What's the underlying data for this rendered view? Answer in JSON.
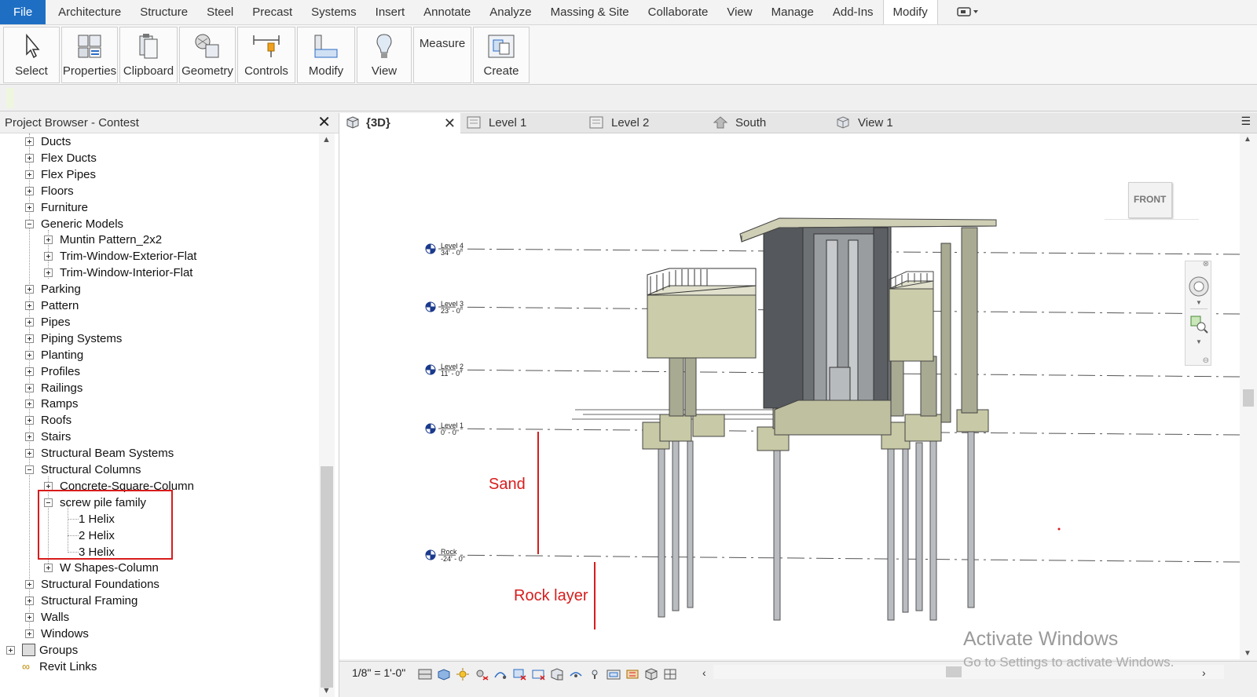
{
  "menu": {
    "file": "File",
    "tabs": [
      "Architecture",
      "Structure",
      "Steel",
      "Precast",
      "Systems",
      "Insert",
      "Annotate",
      "Analyze",
      "Massing & Site",
      "Collaborate",
      "View",
      "Manage",
      "Add-Ins"
    ],
    "active": "Modify",
    "extra_icon": "window-switch-icon"
  },
  "ribbon": {
    "buttons": [
      {
        "label": "Select",
        "icon": "cursor-icon"
      },
      {
        "label": "Properties",
        "icon": "properties-icon"
      },
      {
        "label": "Clipboard",
        "icon": "clipboard-icon"
      },
      {
        "label": "Geometry",
        "icon": "geometry-icon"
      },
      {
        "label": "Controls",
        "icon": "controls-icon"
      },
      {
        "label": "Modify",
        "icon": "modify-icon"
      },
      {
        "label": "View",
        "icon": "lightbulb-icon"
      },
      {
        "label": "Measure",
        "icon": ""
      },
      {
        "label": "Create",
        "icon": "create-icon"
      }
    ]
  },
  "browser": {
    "title": "Project Browser - Contest",
    "items": [
      {
        "label": "Ducts",
        "level": 1,
        "state": "plus"
      },
      {
        "label": "Flex Ducts",
        "level": 1,
        "state": "plus"
      },
      {
        "label": "Flex Pipes",
        "level": 1,
        "state": "plus"
      },
      {
        "label": "Floors",
        "level": 1,
        "state": "plus"
      },
      {
        "label": "Furniture",
        "level": 1,
        "state": "plus"
      },
      {
        "label": "Generic Models",
        "level": 1,
        "state": "minus"
      },
      {
        "label": "Muntin Pattern_2x2",
        "level": 2,
        "state": "plus"
      },
      {
        "label": "Trim-Window-Exterior-Flat",
        "level": 2,
        "state": "plus"
      },
      {
        "label": "Trim-Window-Interior-Flat",
        "level": 2,
        "state": "plus"
      },
      {
        "label": "Parking",
        "level": 1,
        "state": "plus"
      },
      {
        "label": "Pattern",
        "level": 1,
        "state": "plus"
      },
      {
        "label": "Pipes",
        "level": 1,
        "state": "plus"
      },
      {
        "label": "Piping Systems",
        "level": 1,
        "state": "plus"
      },
      {
        "label": "Planting",
        "level": 1,
        "state": "plus"
      },
      {
        "label": "Profiles",
        "level": 1,
        "state": "plus"
      },
      {
        "label": "Railings",
        "level": 1,
        "state": "plus"
      },
      {
        "label": "Ramps",
        "level": 1,
        "state": "plus"
      },
      {
        "label": "Roofs",
        "level": 1,
        "state": "plus"
      },
      {
        "label": "Stairs",
        "level": 1,
        "state": "plus"
      },
      {
        "label": "Structural Beam Systems",
        "level": 1,
        "state": "plus"
      },
      {
        "label": "Structural Columns",
        "level": 1,
        "state": "minus"
      },
      {
        "label": "Concrete-Square-Column",
        "level": 2,
        "state": "plus"
      },
      {
        "label": "screw pile family",
        "level": 2,
        "state": "minus"
      },
      {
        "label": "1 Helix",
        "level": 3,
        "state": "leaf"
      },
      {
        "label": "2 Helix",
        "level": 3,
        "state": "leaf"
      },
      {
        "label": "3 Helix",
        "level": 3,
        "state": "leaf"
      },
      {
        "label": "W Shapes-Column",
        "level": 2,
        "state": "plus"
      },
      {
        "label": "Structural Foundations",
        "level": 1,
        "state": "plus"
      },
      {
        "label": "Structural Framing",
        "level": 1,
        "state": "plus"
      },
      {
        "label": "Walls",
        "level": 1,
        "state": "plus"
      },
      {
        "label": "Windows",
        "level": 1,
        "state": "plus"
      },
      {
        "label": "Groups",
        "level": 0,
        "state": "plus"
      },
      {
        "label": "Revit Links",
        "level": 0,
        "state": "link"
      }
    ]
  },
  "view_tabs": [
    {
      "label": "{3D}",
      "icon": "3d-view-icon",
      "active": true
    },
    {
      "label": "Level 1",
      "icon": "floor-plan-icon",
      "active": false
    },
    {
      "label": "Level 2",
      "icon": "floor-plan-icon",
      "active": false
    },
    {
      "label": "South",
      "icon": "elevation-icon",
      "active": false
    },
    {
      "label": "View 1",
      "icon": "3d-view-icon",
      "active": false
    }
  ],
  "view": {
    "viewcube_face": "FRONT",
    "levels": [
      {
        "name": "Level 4",
        "elev": "34' - 0\""
      },
      {
        "name": "Level 3",
        "elev": "23' - 0\""
      },
      {
        "name": "Level 2",
        "elev": "11' - 0\""
      },
      {
        "name": "Level 1",
        "elev": "0' - 0\""
      },
      {
        "name": "Rock",
        "elev": "-24' - 0\""
      }
    ],
    "annotations": {
      "sand": "Sand",
      "rock": "Rock layer"
    },
    "annotation_color": "#d81c1c"
  },
  "status": {
    "scale": "1/8\" = 1'-0\""
  },
  "watermark": {
    "line1": "Activate Windows",
    "line2": "Go to Settings to activate Windows."
  }
}
